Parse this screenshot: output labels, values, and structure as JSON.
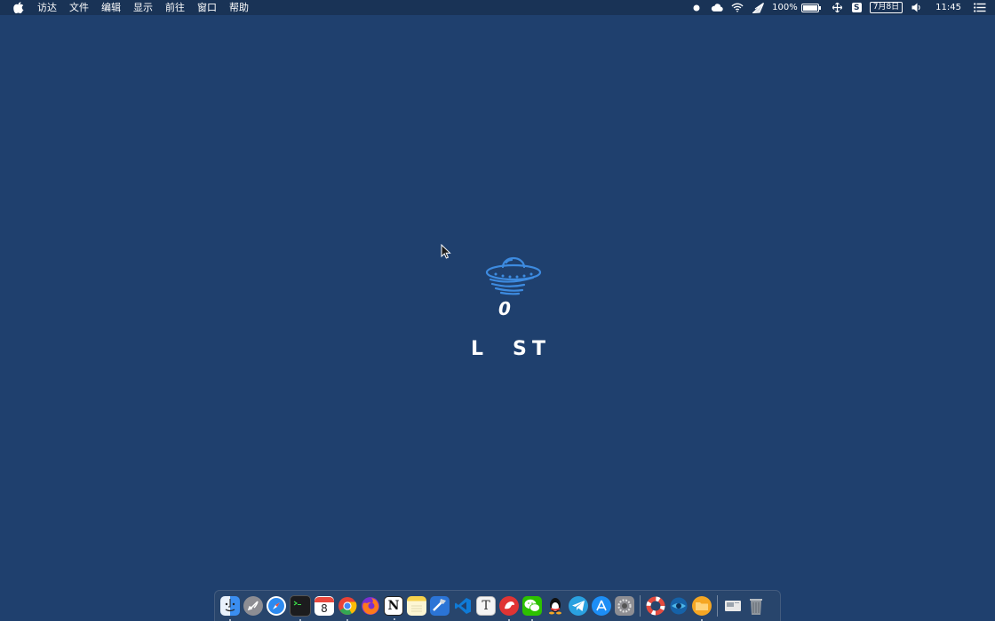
{
  "menubar": {
    "apple_icon": "apple-logo-icon",
    "items": [
      "访达",
      "文件",
      "编辑",
      "显示",
      "前往",
      "窗口",
      "帮助"
    ],
    "tray": {
      "battery_percent": "100%",
      "battery_level": 1.0,
      "sogou_label": "S",
      "date": "7月8日",
      "time": "11:45"
    }
  },
  "splash": {
    "icon": "ufo-icon",
    "zero": "0",
    "letters": [
      "L",
      "S",
      "T"
    ]
  },
  "dock": {
    "apps": [
      {
        "name": "finder",
        "icon": "finder-icon",
        "running": true
      },
      {
        "name": "launchpad",
        "icon": "launchpad-rocket-icon",
        "running": false
      },
      {
        "name": "safari",
        "icon": "safari-compass-icon",
        "running": false
      },
      {
        "name": "terminal",
        "icon": "terminal-icon",
        "running": true
      },
      {
        "name": "calendar",
        "icon": "calendar-icon",
        "label": "8",
        "running": false
      },
      {
        "name": "chrome",
        "icon": "chrome-icon",
        "running": true
      },
      {
        "name": "firefox",
        "icon": "firefox-icon",
        "running": false
      },
      {
        "name": "notion",
        "icon": "notion-icon",
        "label": "N",
        "running": true
      },
      {
        "name": "notes",
        "icon": "notes-icon",
        "running": false
      },
      {
        "name": "xcode",
        "icon": "xcode-hammer-icon",
        "running": false
      },
      {
        "name": "vscode",
        "icon": "vscode-icon",
        "running": false
      },
      {
        "name": "typora",
        "icon": "typora-icon",
        "label": "T",
        "running": false
      },
      {
        "name": "scrobbles",
        "icon": "red-bird-icon",
        "running": true
      },
      {
        "name": "wechat",
        "icon": "wechat-icon",
        "running": true
      },
      {
        "name": "qq",
        "icon": "qq-penguin-icon",
        "running": false
      },
      {
        "name": "telegram",
        "icon": "telegram-plane-icon",
        "running": false
      },
      {
        "name": "app-store",
        "icon": "app-store-icon",
        "running": false
      },
      {
        "name": "system-preferences",
        "icon": "gear-icon",
        "running": false
      },
      {
        "name": "help-ring",
        "icon": "lifebuoy-icon",
        "running": false
      },
      {
        "name": "browser",
        "icon": "globe-icon",
        "running": false
      },
      {
        "name": "orange-app",
        "icon": "orange-folder-icon",
        "running": true
      },
      {
        "name": "downloads",
        "icon": "downloads-stack-icon",
        "running": false
      },
      {
        "name": "trash",
        "icon": "trash-icon",
        "running": false
      }
    ]
  },
  "colors": {
    "desktop": "#1f406e",
    "menubar": "#193356",
    "ufo": "#3d8be0"
  }
}
